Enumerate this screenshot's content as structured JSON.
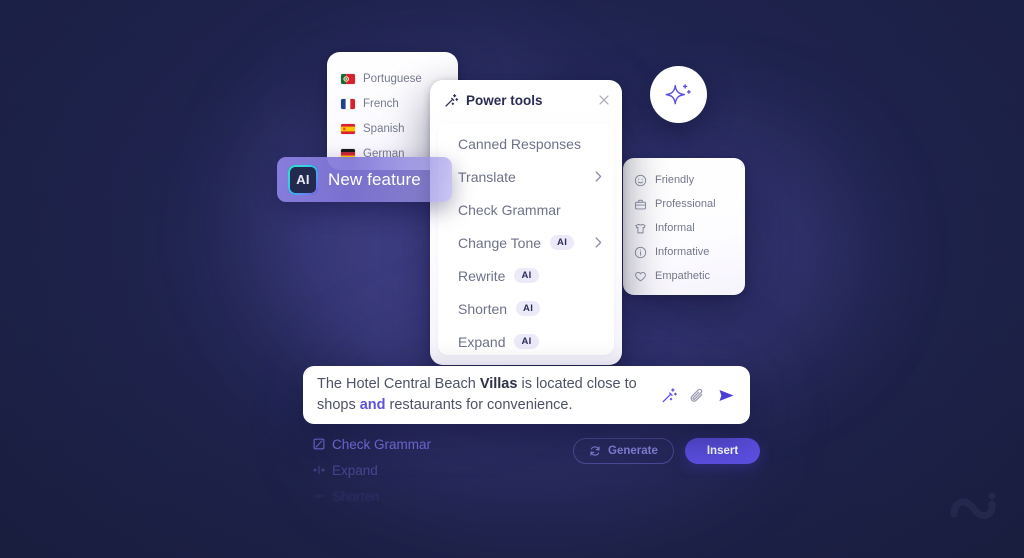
{
  "theme": {
    "background": "#1b2044",
    "accent": "#5b4fe0",
    "panel_bg": "#ffffff",
    "muted_text": "#74788d",
    "highlight_text": "#5c53d8"
  },
  "languages_panel": {
    "name": "languages-list",
    "items": [
      {
        "label": "Portuguese",
        "flag": "flag-pt"
      },
      {
        "label": "French",
        "flag": "flag-fr"
      },
      {
        "label": "Spanish",
        "flag": "flag-es"
      },
      {
        "label": "German",
        "flag": "flag-de"
      }
    ]
  },
  "new_feature_badge": {
    "chip_label": "AI",
    "label": "New feature"
  },
  "power_tools": {
    "title": "Power tools",
    "header_icon": "magic-wand-icon",
    "close_icon": "close-icon",
    "items": [
      {
        "label": "Canned Responses",
        "badge": "",
        "chevron": false
      },
      {
        "label": "Translate",
        "badge": "",
        "chevron": true
      },
      {
        "label": "Check Grammar",
        "badge": "",
        "chevron": false
      },
      {
        "label": "Change Tone",
        "badge": "AI",
        "chevron": true
      },
      {
        "label": "Rewrite",
        "badge": "AI",
        "chevron": false
      },
      {
        "label": "Shorten",
        "badge": "AI",
        "chevron": false
      },
      {
        "label": "Expand",
        "badge": "AI",
        "chevron": false
      }
    ]
  },
  "tone_panel": {
    "items": [
      {
        "label": "Friendly",
        "icon": "smiley-face-icon"
      },
      {
        "label": "Professional",
        "icon": "briefcase-icon"
      },
      {
        "label": "Informal",
        "icon": "t-shirt-icon"
      },
      {
        "label": "Informative",
        "icon": "info-circle-icon"
      },
      {
        "label": "Empathetic",
        "icon": "heart-icon"
      }
    ]
  },
  "sparkle_badge": {
    "icon": "sparkle-icon"
  },
  "composer": {
    "text_part_1": "The Hotel Central Beach ",
    "text_bold": "Villas",
    "text_part_2": " is located close to shops ",
    "text_highlight": "and",
    "text_part_3": " restaurants for convenience.",
    "actions": [
      {
        "icon": "magic-wand-icon",
        "name": "magic-wand-button"
      },
      {
        "icon": "paperclip-icon",
        "name": "attach-button"
      },
      {
        "icon": "send-icon",
        "name": "send-button"
      }
    ]
  },
  "suggestions": [
    {
      "label": "Check Grammar",
      "icon": "grammar-check-icon"
    },
    {
      "label": "Expand",
      "icon": "expand-icon"
    },
    {
      "label": "Shorten",
      "icon": "shorten-icon"
    }
  ],
  "action_buttons": {
    "generate_label": "Generate",
    "generate_icon": "refresh-icon",
    "insert_label": "Insert"
  },
  "watermark": {
    "icon": "brand-logo-icon"
  }
}
